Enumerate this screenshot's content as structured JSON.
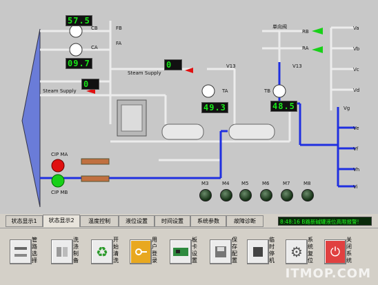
{
  "process": {
    "cb_label": "CB",
    "ca_label": "CA",
    "fb_label": "FB",
    "fa_label": "FA",
    "lcd_cb": "57.5",
    "lcd_ca": "09.7",
    "lcd_steam_left": "0",
    "lcd_steam_right": "0",
    "steam_supply_left": "Steam Supply",
    "steam_supply_right": "Steam Supply",
    "v13_a": "V13",
    "v13_b": "V13",
    "one_way_valve": "单向阀",
    "rb_label": "RB",
    "ra_label": "RA",
    "ta_label": "TA",
    "tb_label": "TB",
    "lcd_ta": "49.3",
    "lcd_tb": "48.5",
    "vg_label": "Vg",
    "cip_ma": "CIP MA",
    "cip_mb": "CIP MB",
    "valves": [
      "Va",
      "Vb",
      "Vc",
      "Vd",
      "Ve",
      "Vf",
      "Vh",
      "Vi"
    ],
    "motors": [
      "M3",
      "M4",
      "M5",
      "M6",
      "M7",
      "M8"
    ]
  },
  "tabs": [
    {
      "label": "状态显示1",
      "active": false
    },
    {
      "label": "状态显示2",
      "active": true
    },
    {
      "label": "温度控制",
      "active": false
    },
    {
      "label": "液位设置",
      "active": false
    },
    {
      "label": "时间设置",
      "active": false
    },
    {
      "label": "系统参数",
      "active": false
    },
    {
      "label": "故障诊断",
      "active": false
    }
  ],
  "status_text": "8:48:16 B路新碱罐液位高限报警!",
  "toolbar": [
    {
      "label": "管路选择",
      "icon": "pipeline-icon"
    },
    {
      "label": "洗涤制备",
      "icon": "tanks-icon"
    },
    {
      "label": "开始清洗",
      "icon": "recycle-icon"
    },
    {
      "label": "用户登录",
      "icon": "key-icon"
    },
    {
      "label": "板卡设置",
      "icon": "board-icon"
    },
    {
      "label": "保存配置",
      "icon": "save-icon"
    },
    {
      "label": "临时停机",
      "icon": "stop-icon"
    },
    {
      "label": "系统复位",
      "icon": "gear-icon"
    },
    {
      "label": "关闭系统",
      "icon": "power-icon"
    }
  ],
  "watermark": "ITMOP.COM",
  "colors": {
    "pipe_blue": "#1f2fe0",
    "pipe_grey": "#e4e4e4",
    "lcd_green": "#19e619",
    "pump_red": "#e01010",
    "pump_green": "#18d018"
  }
}
